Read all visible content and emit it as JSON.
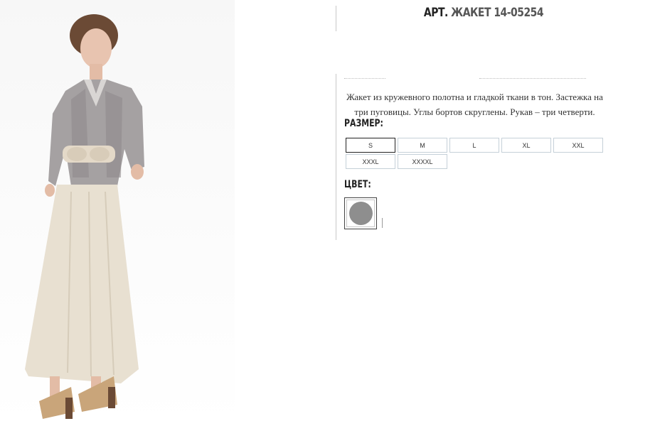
{
  "product": {
    "title_prefix": "АРТ.",
    "title_name": "ЖАКЕТ 14-05254",
    "description": "Жакет из кружевного полотна и гладкой ткани в тон. Застежка на три пуговицы. Углы бортов скруглены. Рукав – три четверти."
  },
  "size_section": {
    "label": "РАЗМЕР:",
    "selected": "S",
    "options": [
      "S",
      "M",
      "L",
      "XL",
      "XXL",
      "XXXL",
      "XXXXL"
    ]
  },
  "color_section": {
    "label": "ЦВЕТ:",
    "selected_color": "#8e8e8e"
  },
  "image": {
    "subject": "model-in-jacket-and-long-skirt"
  }
}
